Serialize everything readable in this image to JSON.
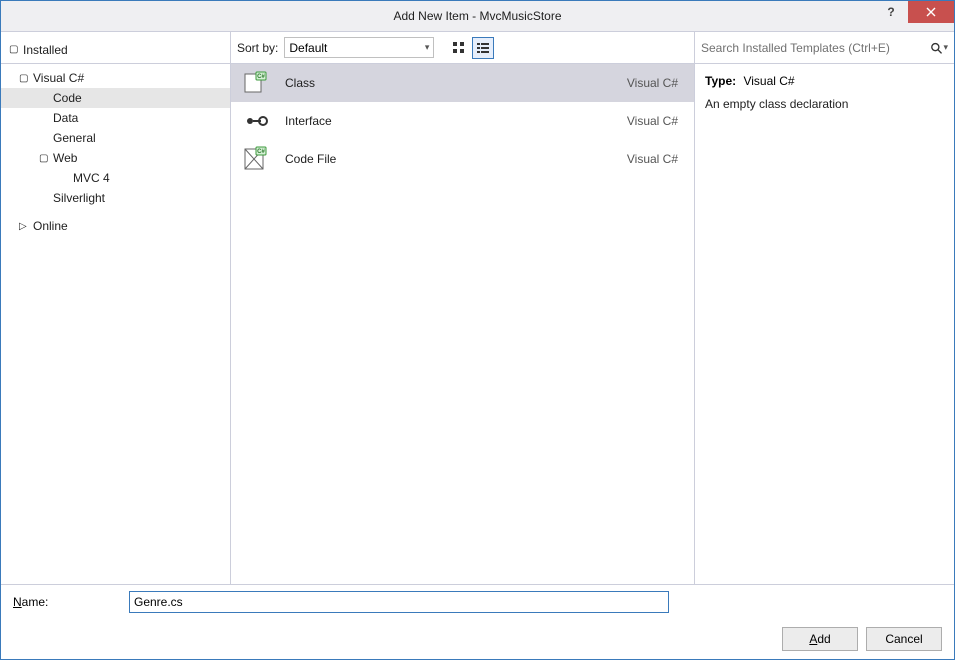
{
  "window": {
    "title": "Add New Item - MvcMusicStore"
  },
  "tree": {
    "header": "Installed",
    "items": [
      {
        "label": "Visual C#",
        "level": 1,
        "expander": "▢",
        "selected": false
      },
      {
        "label": "Code",
        "level": 2,
        "expander": "",
        "selected": true
      },
      {
        "label": "Data",
        "level": 2,
        "expander": "",
        "selected": false
      },
      {
        "label": "General",
        "level": 2,
        "expander": "",
        "selected": false
      },
      {
        "label": "Web",
        "level": 2,
        "expander": "▢",
        "selected": false
      },
      {
        "label": "MVC 4",
        "level": 3,
        "expander": "",
        "selected": false
      },
      {
        "label": "Silverlight",
        "level": 2,
        "expander": "",
        "selected": false
      },
      {
        "label": "Online",
        "level": 1,
        "expander": "▷",
        "selected": false
      }
    ]
  },
  "toolbar": {
    "sort_label": "Sort by:",
    "sort_value": "Default"
  },
  "templates": [
    {
      "name": "Class",
      "lang": "Visual C#",
      "selected": true,
      "icon": "class"
    },
    {
      "name": "Interface",
      "lang": "Visual C#",
      "selected": false,
      "icon": "interface"
    },
    {
      "name": "Code File",
      "lang": "Visual C#",
      "selected": false,
      "icon": "codefile"
    }
  ],
  "search": {
    "placeholder": "Search Installed Templates (Ctrl+E)"
  },
  "details": {
    "type_label": "Type:",
    "type_value": "Visual C#",
    "description": "An empty class declaration"
  },
  "footer": {
    "name_label_prefix": "N",
    "name_label_rest": "ame:",
    "name_value": "Genre.cs",
    "add_prefix": "A",
    "add_rest": "dd",
    "cancel": "Cancel"
  }
}
